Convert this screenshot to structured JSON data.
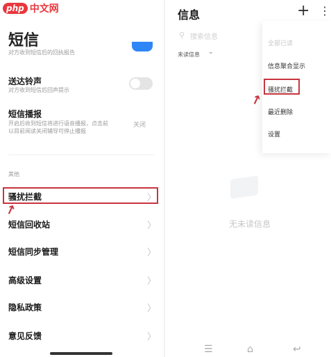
{
  "watermark": {
    "logo_text": "php",
    "site_text": "中文网"
  },
  "left": {
    "title": "短信",
    "top_partial_sub": "对方收到短信后的回执报告",
    "items": [
      {
        "title": "送达铃声",
        "subtitle": "对方收到短信后回声提示"
      },
      {
        "title": "短信播报",
        "subtitle_line1": "开启后收到短信将进行语音播报，点击前",
        "subtitle_line2": "以目前阅读关闭辅导可停止播报",
        "value": "关闭"
      }
    ],
    "section_label": "其他",
    "menu": [
      {
        "label": "骚扰拦截",
        "chevron": "〉",
        "highlighted": true
      },
      {
        "label": "短信回收站",
        "chevron": "〉"
      },
      {
        "label": "短信同步管理",
        "chevron": "〉"
      },
      {
        "label": "高级设置",
        "chevron": "〉"
      },
      {
        "label": "隐私政策",
        "chevron": "〉"
      },
      {
        "label": "意见反馈",
        "chevron": "〉"
      }
    ],
    "highlight_color": "#c8343f"
  },
  "right": {
    "title": "信息",
    "plus_icon": "+",
    "more_icon": "⋮",
    "search_placeholder": "搜索信息",
    "filter_label": "未读信息",
    "filter_chevron": "⌄",
    "popup_menu": [
      {
        "label": "全部已读",
        "faded": true
      },
      {
        "label": "信息聚合显示"
      },
      {
        "label": "骚扰拦截",
        "highlighted": true
      },
      {
        "label": "最近删除"
      },
      {
        "label": "设置"
      }
    ],
    "empty_text": "无未读信息",
    "nav_keys": [
      "☰",
      "⌂",
      "↩"
    ]
  }
}
